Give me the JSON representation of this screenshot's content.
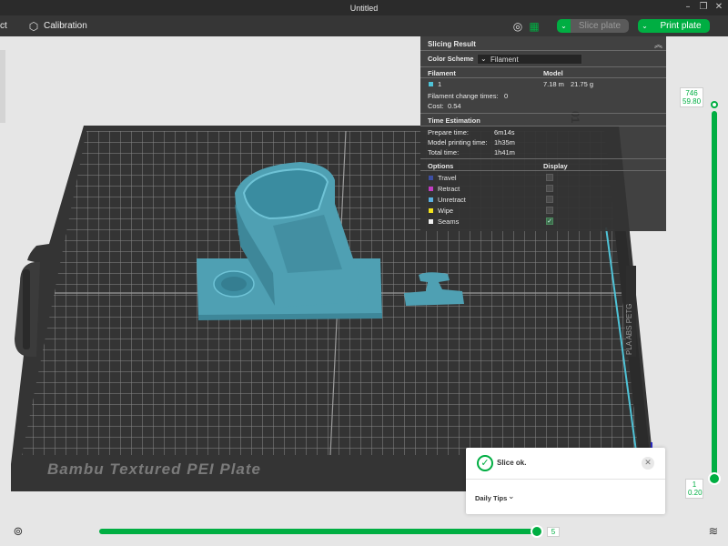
{
  "window": {
    "title": "Untitled"
  },
  "toolbar": {
    "left_item": "ct",
    "calibration_label": "Calibration",
    "slice_label": "Slice plate",
    "print_label": "Print plate"
  },
  "plate": {
    "name": "Bambu Textured PEI Plate",
    "side_text": "PLA ABS PETG"
  },
  "slicing_result": {
    "title": "Slicing Result",
    "color_scheme_label": "Color Scheme",
    "color_scheme_value": "Filament",
    "filament_header": "Filament",
    "model_header": "Model",
    "filament": {
      "id": "1",
      "color": "#4fc3d7",
      "length": "7.18 m",
      "weight": "21.75 g"
    },
    "change_times_label": "Filament change times:",
    "change_times_value": "0",
    "cost_label": "Cost:",
    "cost_value": "0.54",
    "time_header": "Time Estimation",
    "times": [
      {
        "label": "Prepare time:",
        "value": "6m14s"
      },
      {
        "label": "Model printing time:",
        "value": "1h35m"
      },
      {
        "label": "Total time:",
        "value": "1h41m"
      }
    ],
    "options_header": "Options",
    "display_header": "Display",
    "options": [
      {
        "label": "Travel",
        "color": "#3d4fa3",
        "checked": false
      },
      {
        "label": "Retract",
        "color": "#c23cc2",
        "checked": false
      },
      {
        "label": "Unretract",
        "color": "#5bb0e0",
        "checked": false
      },
      {
        "label": "Wipe",
        "color": "#f2e21c",
        "checked": false
      },
      {
        "label": "Seams",
        "color": "#f0f0f0",
        "checked": true
      }
    ]
  },
  "layer_slider": {
    "top_layer": "746",
    "top_height": "59.80",
    "bottom_layer": "1",
    "bottom_height": "0.20"
  },
  "move_slider": {
    "value": "5"
  },
  "notification": {
    "message": "Slice ok.",
    "tips_label": "Daily Tips"
  },
  "colors": {
    "accent": "#00ae42",
    "model": "#4fa0b3",
    "bed": "#3b3b3b"
  }
}
